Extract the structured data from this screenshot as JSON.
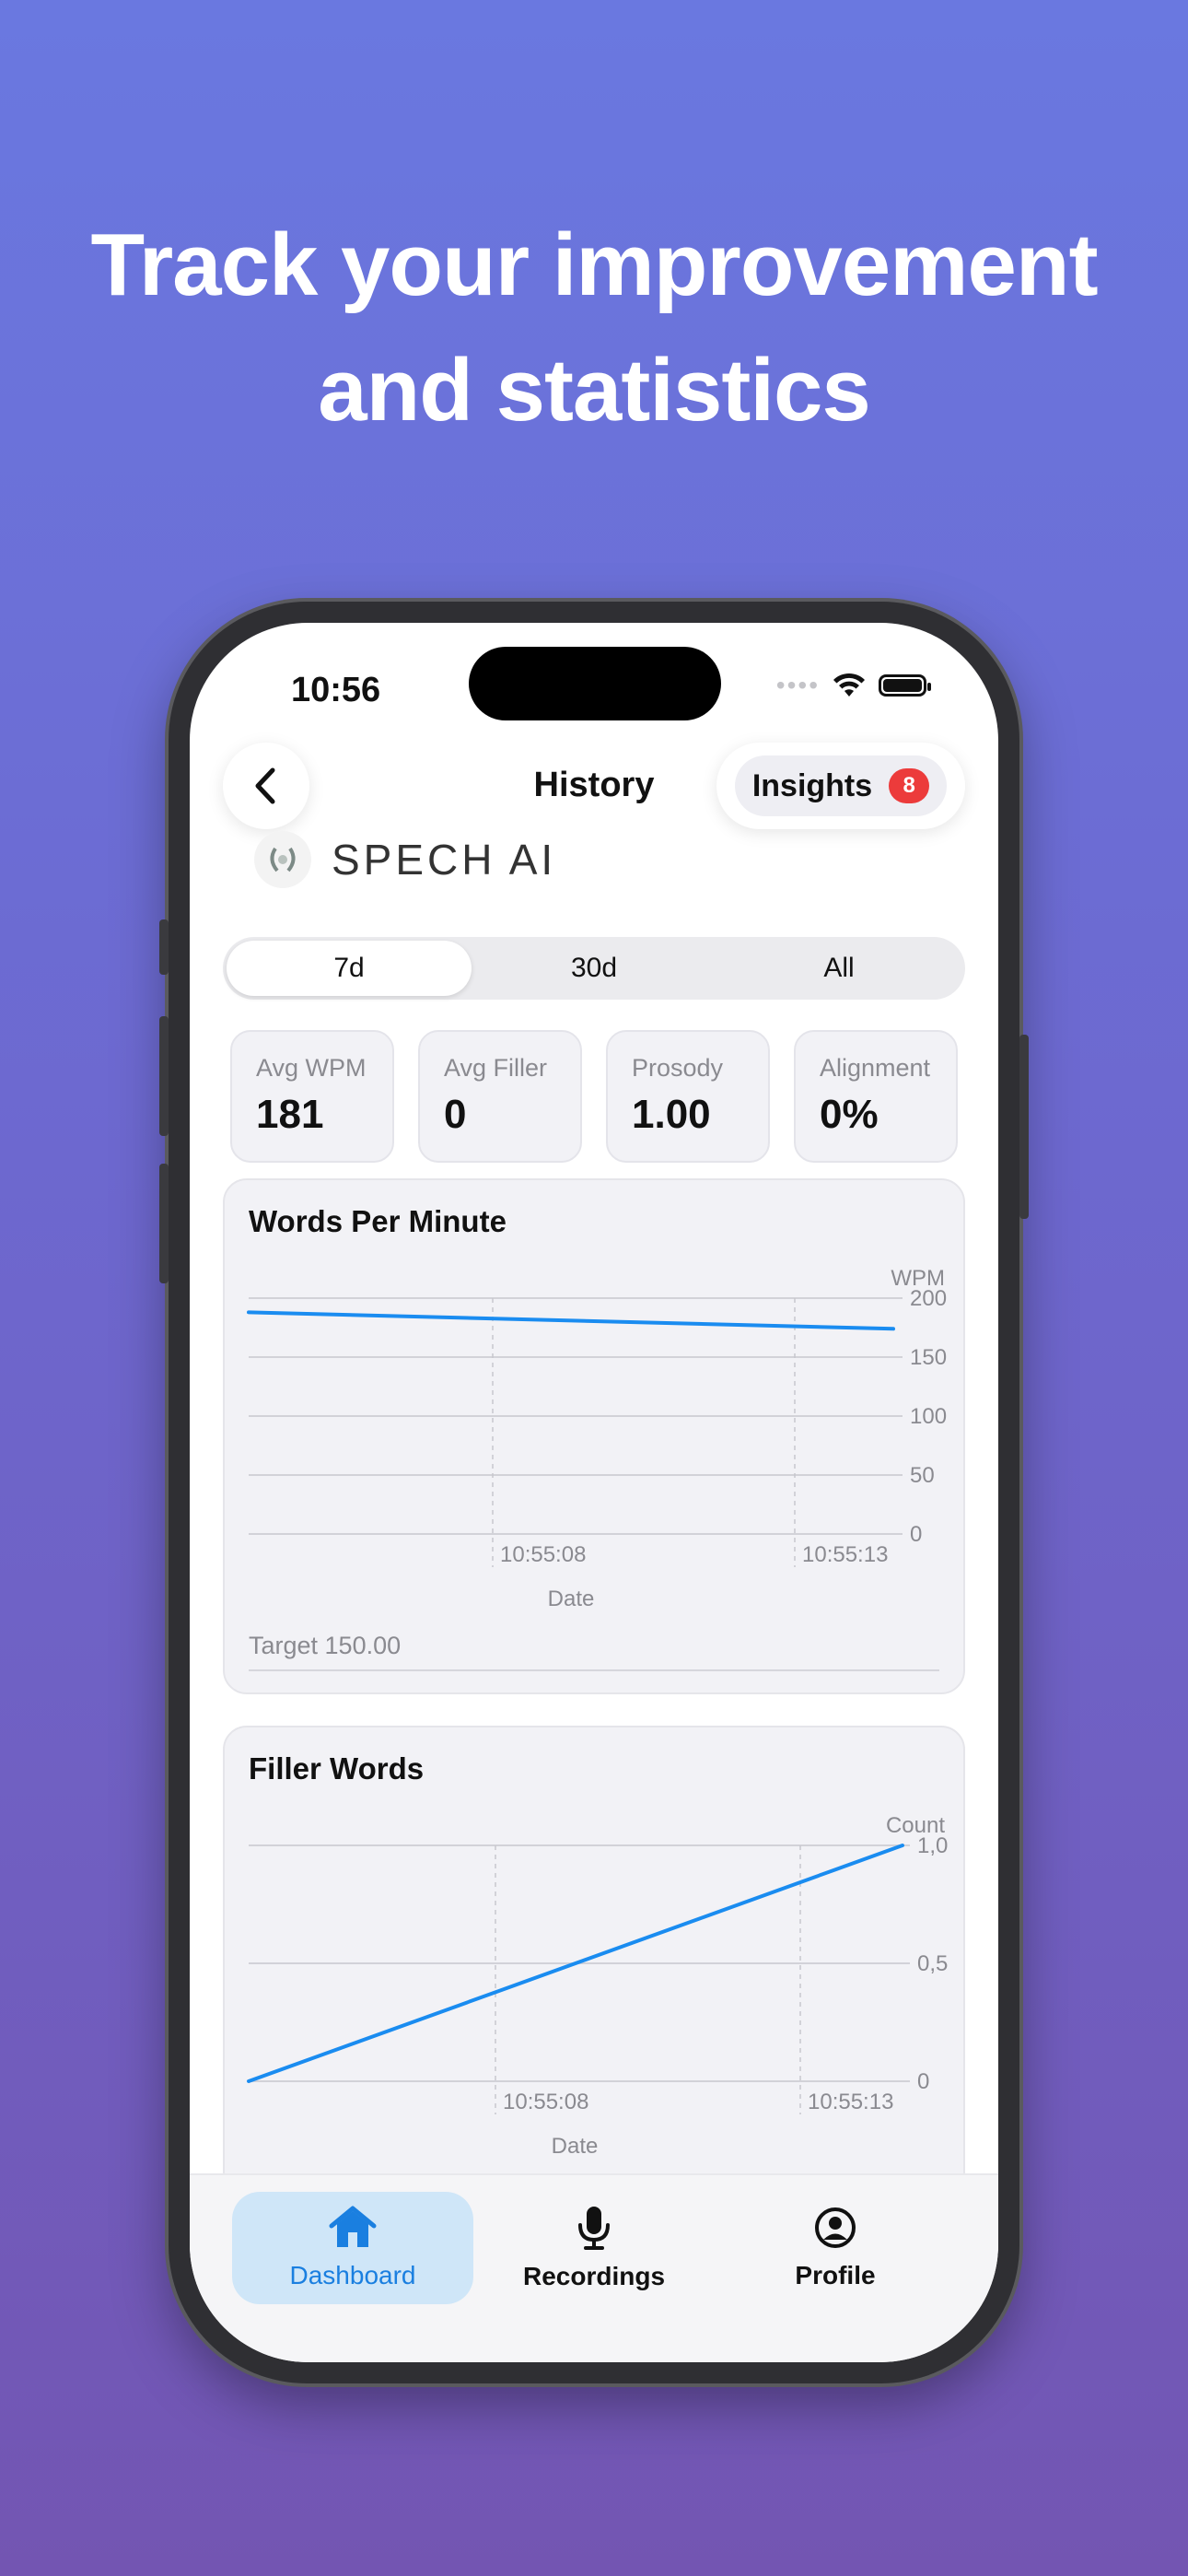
{
  "headline": {
    "line1": "Track your improvement",
    "line2": "and statistics"
  },
  "status_bar": {
    "time": "10:56"
  },
  "nav": {
    "title": "History",
    "insights_label": "Insights",
    "insights_count": "8"
  },
  "brand": {
    "name": "SPECH AI"
  },
  "range_selector": {
    "options": [
      "7d",
      "30d",
      "All"
    ],
    "selected": "7d"
  },
  "stats": [
    {
      "label": "Avg WPM",
      "value": "181"
    },
    {
      "label": "Avg Filler",
      "value": "0"
    },
    {
      "label": "Prosody",
      "value": "1.00"
    },
    {
      "label": "Alignment",
      "value": "0%"
    }
  ],
  "wpm_card": {
    "title": "Words Per Minute",
    "target": "Target 150.00"
  },
  "filler_card": {
    "title": "Filler Words"
  },
  "tabbar": {
    "dashboard": "Dashboard",
    "recordings": "Recordings",
    "profile": "Profile",
    "active": "Dashboard"
  },
  "colors": {
    "accent": "#1a8cf0",
    "tab_active_bg": "#cfe6f8",
    "badge": "#ec3b3b"
  },
  "chart_data": [
    {
      "type": "line",
      "title": "Words Per Minute",
      "xlabel": "Date",
      "ylabel": "WPM",
      "x_ticks": [
        "10:55:08",
        "10:55:13"
      ],
      "y_ticks": [
        "0",
        "50",
        "100",
        "150",
        "200"
      ],
      "ylim": [
        0,
        200
      ],
      "series": [
        {
          "values": [
            188,
            174
          ]
        }
      ],
      "grid": true
    },
    {
      "type": "line",
      "title": "Filler Words",
      "xlabel": "Date",
      "ylabel": "Count",
      "x_ticks": [
        "10:55:08",
        "10:55:13"
      ],
      "y_ticks": [
        "0",
        "0,5",
        "1,0"
      ],
      "ylim": [
        0,
        1
      ],
      "series": [
        {
          "values": [
            0,
            1
          ]
        }
      ],
      "grid": true
    }
  ]
}
